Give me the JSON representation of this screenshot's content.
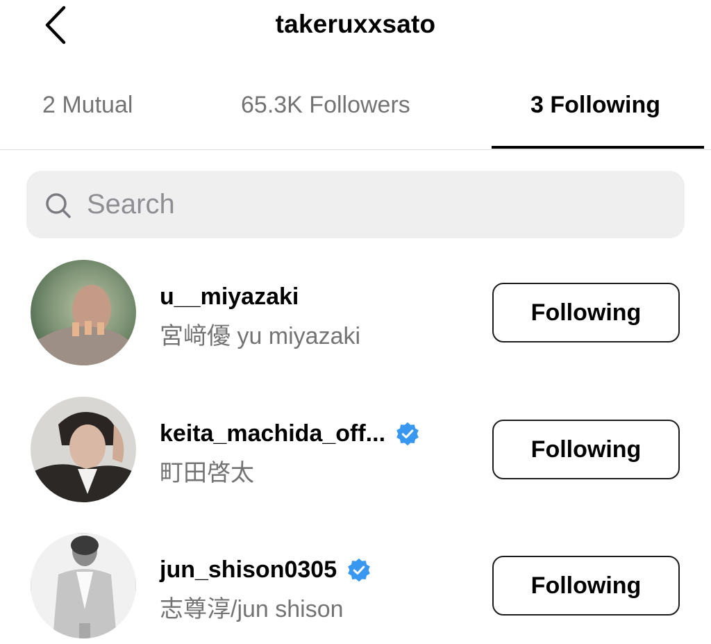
{
  "header": {
    "title": "takeruxxsato",
    "back_icon": "chevron-left-icon"
  },
  "tabs": [
    {
      "label": "2 Mutual",
      "active": false
    },
    {
      "label": "65.3K Followers",
      "active": false
    },
    {
      "label": "3 Following",
      "active": true
    }
  ],
  "search": {
    "placeholder": "Search",
    "value": "",
    "icon": "search-icon"
  },
  "accounts": [
    {
      "username": "u__miyazaki",
      "full_name": "宮﨑優 yu miyazaki",
      "verified": false,
      "button_label": "Following"
    },
    {
      "username": "keita_machida_off...",
      "full_name": "町田啓太",
      "verified": true,
      "button_label": "Following"
    },
    {
      "username": "jun_shison0305",
      "full_name": "志尊淳/jun shison",
      "verified": true,
      "button_label": "Following"
    }
  ],
  "colors": {
    "verified_blue": "#3897f0",
    "secondary_text": "#737373",
    "search_bg": "#efeff0"
  }
}
